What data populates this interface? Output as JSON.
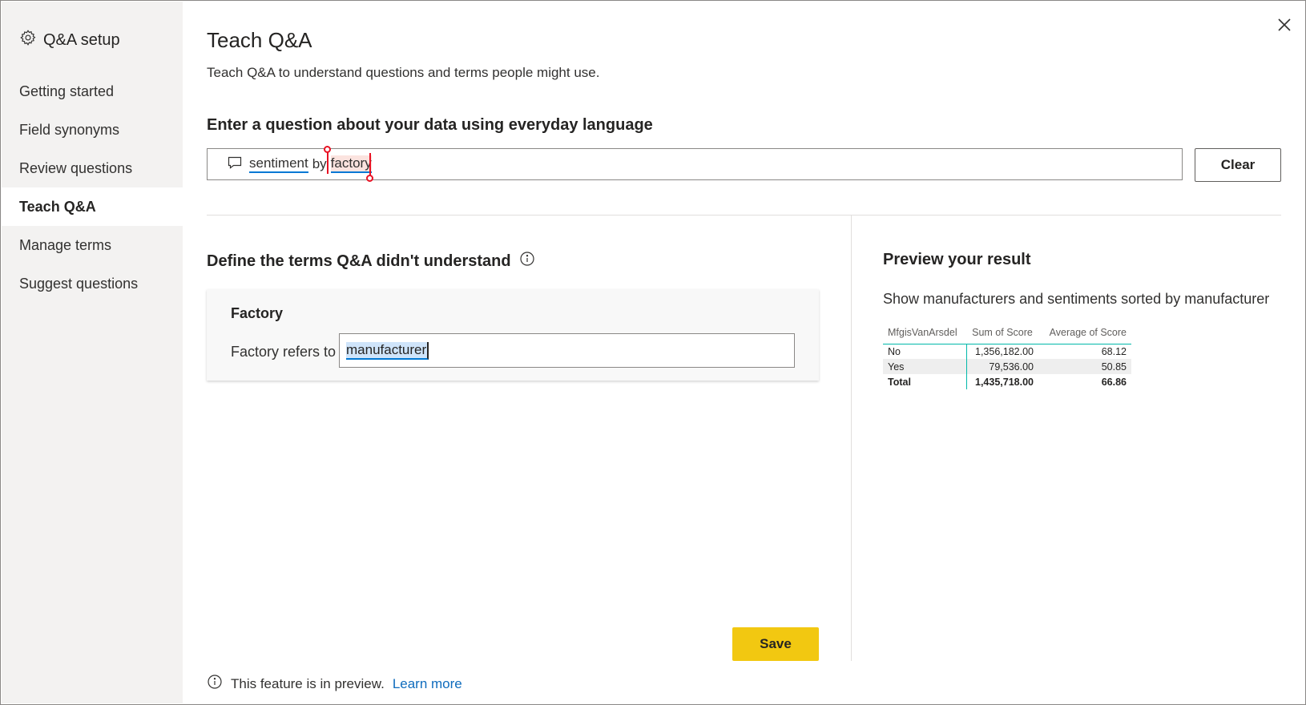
{
  "sidebar": {
    "header": "Q&A setup",
    "items": [
      {
        "label": "Getting started"
      },
      {
        "label": "Field synonyms"
      },
      {
        "label": "Review questions"
      },
      {
        "label": "Teach Q&A"
      },
      {
        "label": "Manage terms"
      },
      {
        "label": "Suggest questions"
      }
    ],
    "active": "Teach Q&A"
  },
  "main": {
    "title": "Teach Q&A",
    "subtitle": "Teach Q&A to understand questions and terms people might use.",
    "question_label": "Enter a question about your data using everyday language",
    "question": {
      "word1": "sentiment",
      "word2": "by",
      "word3": "factory"
    },
    "clear_label": "Clear",
    "define_label": "Define the terms Q&A didn't understand",
    "term": {
      "name": "Factory",
      "refers_label": "Factory refers to",
      "value": "manufacturer"
    },
    "save_label": "Save",
    "footer_text": "This feature is in preview.",
    "footer_link": "Learn more"
  },
  "preview": {
    "title": "Preview your result",
    "description": "Show manufacturers and sentiments sorted by manufacturer",
    "table": {
      "headers": [
        "MfgisVanArsdel",
        "Sum of Score",
        "Average of Score"
      ],
      "rows": [
        [
          "No",
          "1,356,182.00",
          "68.12"
        ],
        [
          "Yes",
          "79,536.00",
          "50.85"
        ]
      ],
      "total": [
        "Total",
        "1,435,718.00",
        "66.86"
      ]
    }
  },
  "colors": {
    "accent": "#0078d4",
    "save": "#f2c811",
    "table_rule": "#01b8aa",
    "caret": "#e81123"
  }
}
